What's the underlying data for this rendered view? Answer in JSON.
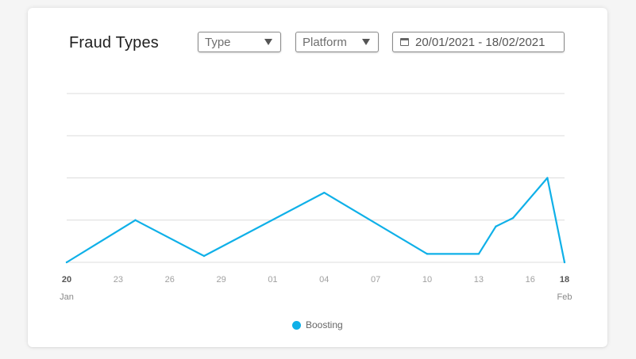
{
  "header": {
    "title": "Fraud Types",
    "type_filter": "Type",
    "platform_filter": "Platform",
    "date_range": "20/01/2021 - 18/02/2021",
    "calendar_icon": "calendar-icon",
    "dropdown_icon": "caret-down-icon"
  },
  "colors": {
    "series": "#0fb0e8",
    "grid": "#dcdcdc"
  },
  "chart_data": {
    "type": "line",
    "title": "Fraud Types",
    "xlabel": "",
    "ylabel": "",
    "grid": true,
    "legend_placement": "bottom-center",
    "x_range": [
      "2021-01-20",
      "2021-02-18"
    ],
    "y_range": [
      0,
      4
    ],
    "x_ticks": [
      {
        "date": "2021-01-20",
        "label": "20",
        "sub": "Jan",
        "bold": true
      },
      {
        "date": "2021-01-23",
        "label": "23"
      },
      {
        "date": "2021-01-26",
        "label": "26"
      },
      {
        "date": "2021-01-29",
        "label": "29"
      },
      {
        "date": "2021-02-01",
        "label": "01"
      },
      {
        "date": "2021-02-04",
        "label": "04"
      },
      {
        "date": "2021-02-07",
        "label": "07"
      },
      {
        "date": "2021-02-10",
        "label": "10"
      },
      {
        "date": "2021-02-13",
        "label": "13"
      },
      {
        "date": "2021-02-16",
        "label": "16"
      },
      {
        "date": "2021-02-18",
        "label": "18",
        "sub": "Feb",
        "bold": true
      }
    ],
    "series": [
      {
        "name": "Boosting",
        "points": [
          {
            "x": "2021-01-20",
            "y": 0
          },
          {
            "x": "2021-01-24",
            "y": 1
          },
          {
            "x": "2021-01-28",
            "y": 0.15
          },
          {
            "x": "2021-02-04",
            "y": 1.65
          },
          {
            "x": "2021-02-10",
            "y": 0.2
          },
          {
            "x": "2021-02-13",
            "y": 0.2
          },
          {
            "x": "2021-02-14",
            "y": 0.85
          },
          {
            "x": "2021-02-15",
            "y": 1.05
          },
          {
            "x": "2021-02-17",
            "y": 2
          },
          {
            "x": "2021-02-18",
            "y": 0
          }
        ]
      }
    ]
  },
  "legend": {
    "items": [
      {
        "label": "Boosting"
      }
    ]
  }
}
